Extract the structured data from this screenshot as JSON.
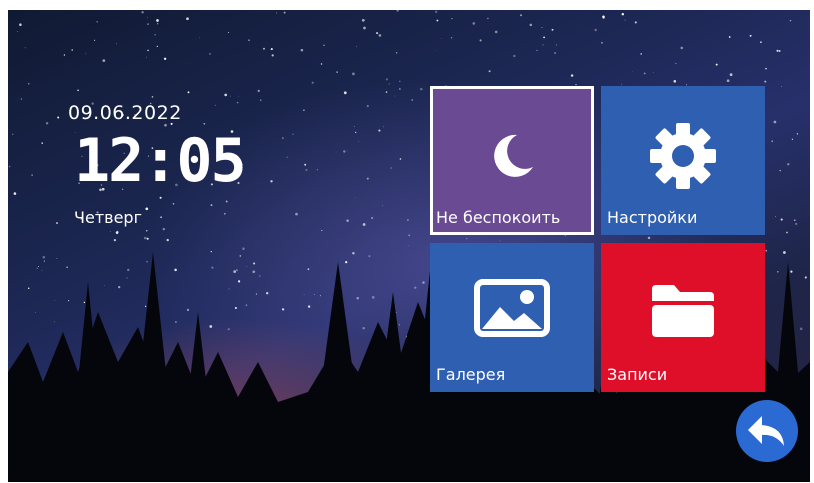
{
  "clock": {
    "date": "09.06.2022",
    "time": "12:05",
    "weekday": "Четверг"
  },
  "tiles": [
    {
      "id": "do-not-disturb",
      "label": "Не беспокоить",
      "icon": "moon-icon",
      "color": "#6a4a93",
      "selected": true
    },
    {
      "id": "settings",
      "label": "Настройки",
      "icon": "gear-icon",
      "color": "#2f5fb0",
      "selected": false
    },
    {
      "id": "gallery",
      "label": "Галерея",
      "icon": "picture-icon",
      "color": "#2f5fb0",
      "selected": false
    },
    {
      "id": "records",
      "label": "Записи",
      "icon": "folder-icon",
      "color": "#df0f2a",
      "selected": false
    }
  ],
  "back_button": {
    "icon": "back-arrow-icon",
    "color": "#2c6ad3"
  }
}
